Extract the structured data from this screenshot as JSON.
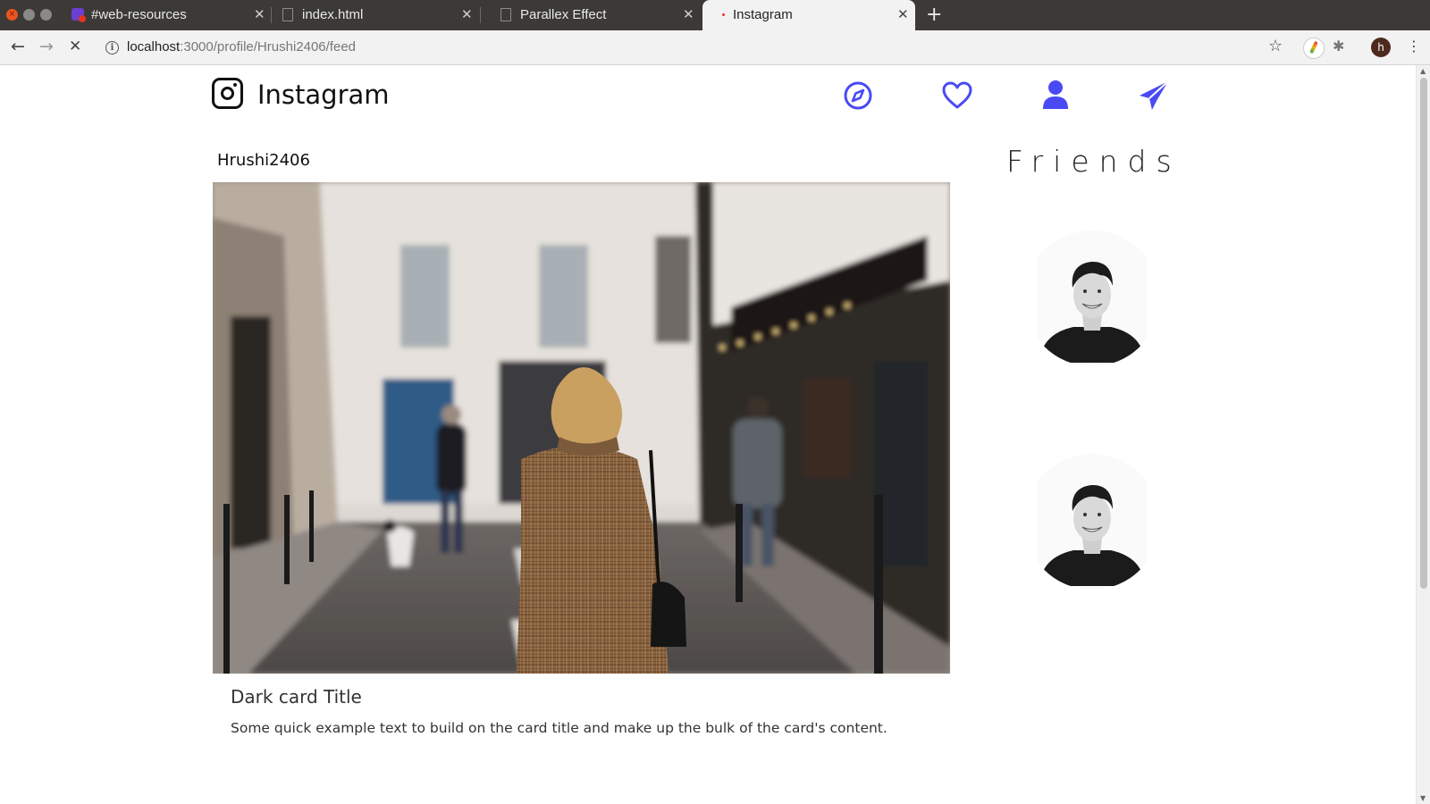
{
  "browser": {
    "tabs": [
      {
        "label": "#web-resources",
        "active": false
      },
      {
        "label": "index.html",
        "active": false
      },
      {
        "label": "Parallex Effect",
        "active": false
      },
      {
        "label": "Instagram",
        "active": true
      }
    ],
    "url_host": "localhost",
    "url_path": ":3000/profile/Hrushi2406/feed",
    "profile_initial": "h"
  },
  "header": {
    "brand_name": "Instagram",
    "nav_icons": [
      "explore-icon",
      "heart-icon",
      "user-icon",
      "send-icon"
    ],
    "accent_color": "#4a4af4"
  },
  "post": {
    "username": "Hrushi2406",
    "card_title": "Dark card Title",
    "card_text": "Some quick example text to build on the card title and make up the bulk of the card's content."
  },
  "friends": {
    "heading": "Friends",
    "count": 2
  }
}
